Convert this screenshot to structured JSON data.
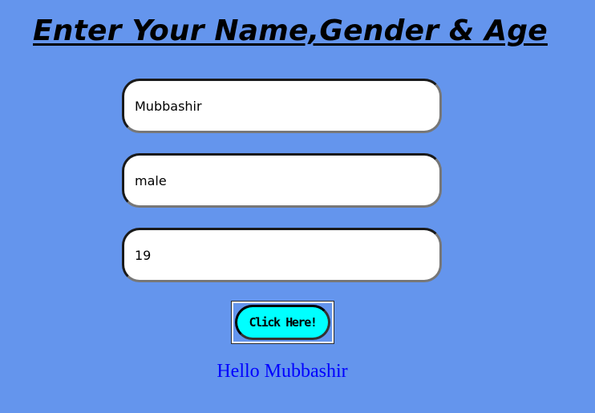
{
  "page": {
    "title": "Enter Your Name,Gender & Age",
    "background_color": "#6495ED"
  },
  "form": {
    "name_value": "Mubbashir",
    "gender_value": "male",
    "age_value": "19",
    "button_label": "Click Here!",
    "button_color": "#00FFFF"
  },
  "output": {
    "greeting": "Hello Mubbashir",
    "greeting_color": "#0000FF"
  }
}
